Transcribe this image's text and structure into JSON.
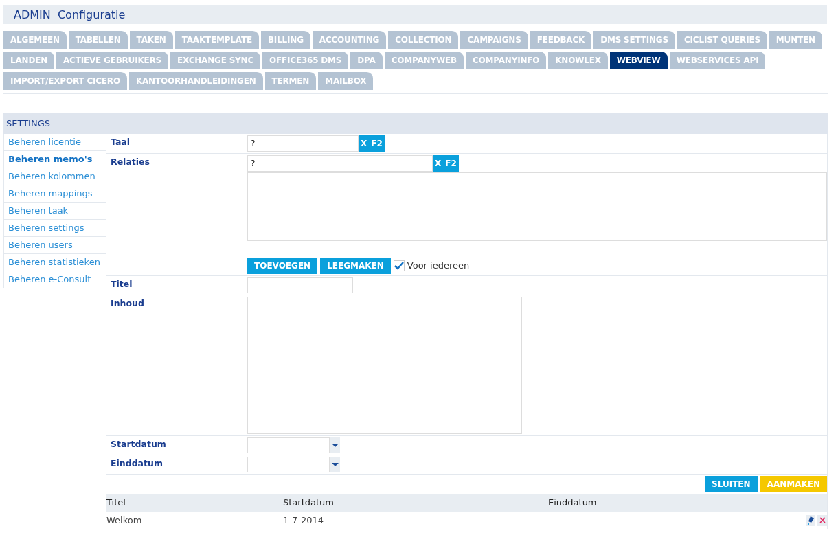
{
  "header": {
    "title": "ADMIN  Configuratie"
  },
  "tab_rows": [
    [
      {
        "label": "ALGEMEEN",
        "selected": false
      },
      {
        "label": "TABELLEN",
        "selected": false
      },
      {
        "label": "TAKEN",
        "selected": false
      },
      {
        "label": "TAAKTEMPLATE",
        "selected": false
      },
      {
        "label": "BILLING",
        "selected": false
      },
      {
        "label": "ACCOUNTING",
        "selected": false
      },
      {
        "label": "COLLECTION",
        "selected": false
      },
      {
        "label": "CAMPAIGNS",
        "selected": false
      },
      {
        "label": "FEEDBACK",
        "selected": false
      },
      {
        "label": "DMS SETTINGS",
        "selected": false
      },
      {
        "label": "CICLIST QUERIES",
        "selected": false
      },
      {
        "label": "MUNTEN",
        "selected": false
      }
    ],
    [
      {
        "label": "LANDEN",
        "selected": false
      },
      {
        "label": "ACTIEVE GEBRUIKERS",
        "selected": false
      },
      {
        "label": "EXCHANGE SYNC",
        "selected": false
      },
      {
        "label": "OFFICE365 DMS",
        "selected": false
      },
      {
        "label": "DPA",
        "selected": false
      },
      {
        "label": "COMPANYWEB",
        "selected": false
      },
      {
        "label": "COMPANYINFO",
        "selected": false
      },
      {
        "label": "KNOWLEX",
        "selected": false
      },
      {
        "label": "WEBVIEW",
        "selected": true
      },
      {
        "label": "WEBSERVICES API",
        "selected": false
      }
    ],
    [
      {
        "label": "IMPORT/EXPORT CICERO",
        "selected": false
      },
      {
        "label": "KANTOORHANDLEIDINGEN",
        "selected": false
      },
      {
        "label": "TERMEN",
        "selected": false
      },
      {
        "label": "MAILBOX",
        "selected": false
      }
    ]
  ],
  "section_title": "SETTINGS",
  "sidebar": {
    "items": [
      {
        "label": "Beheren licentie",
        "selected": false
      },
      {
        "label": "Beheren memo's",
        "selected": true
      },
      {
        "label": "Beheren kolommen",
        "selected": false
      },
      {
        "label": "Beheren mappings",
        "selected": false
      },
      {
        "label": "Beheren taak",
        "selected": false
      },
      {
        "label": "Beheren settings",
        "selected": false
      },
      {
        "label": "Beheren users",
        "selected": false
      },
      {
        "label": "Beheren statistieken",
        "selected": false
      },
      {
        "label": "Beheren e-Consult",
        "selected": false
      }
    ]
  },
  "form": {
    "taal": {
      "label": "Taal",
      "value": "?",
      "clear": "X",
      "lookup": "F2"
    },
    "relaties": {
      "label": "Relaties",
      "value": "?",
      "clear": "X",
      "lookup": "F2",
      "add_button": "TOEVOEGEN",
      "clear_button": "LEEGMAKEN",
      "everyone": {
        "label": "Voor iedereen",
        "checked": true
      }
    },
    "titel": {
      "label": "Titel"
    },
    "inhoud": {
      "label": "Inhoud"
    },
    "startdatum": {
      "label": "Startdatum"
    },
    "einddatum": {
      "label": "Einddatum"
    },
    "buttons": [
      {
        "label": "SLUITEN",
        "kind": "primary"
      },
      {
        "label": "AANMAKEN",
        "kind": "warning"
      }
    ]
  },
  "table": {
    "columns": [
      "Titel",
      "Startdatum",
      "Einddatum"
    ],
    "rows": [
      {
        "cells": [
          "Welkom",
          "1-7-2014",
          ""
        ]
      }
    ]
  }
}
